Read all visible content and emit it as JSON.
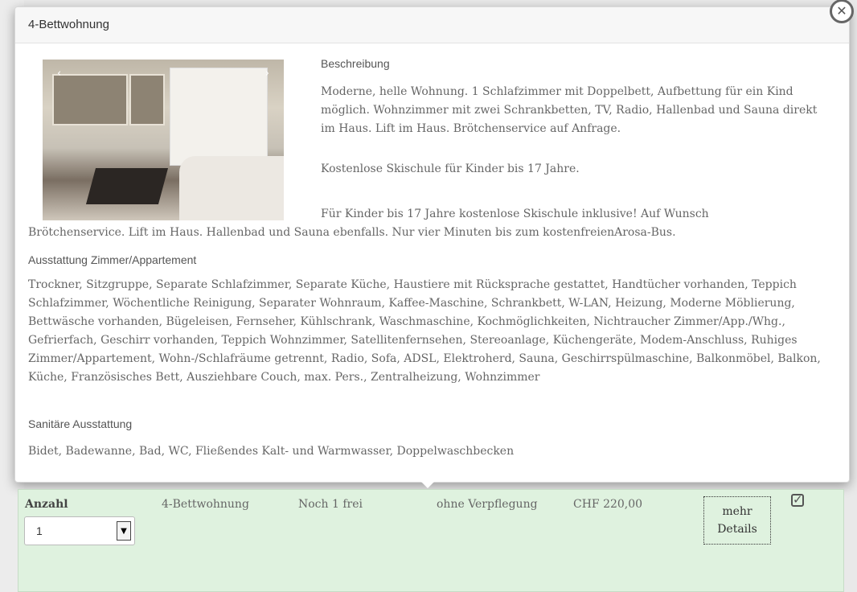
{
  "popup": {
    "title": "4-Bettwohnung",
    "close_icon": "close-icon",
    "description_label": "Beschreibung",
    "description_text": "Moderne, helle Wohnung. 1 Schlafzimmer mit Doppelbett, Aufbettung für ein Kind möglich. Wohnzimmer mit zwei Schrankbetten, TV, Radio, Hallenbad und Sauna direkt im Haus. Lift im Haus. Brötchenservice auf Anfrage.",
    "description_extra": "Kostenlose Skischule für Kinder bis 17 Jahre.",
    "description_more_line1": "Für Kinder bis 17 Jahre kostenlose Skischule inklusive! Auf Wunsch",
    "description_more_line2": "Brötchenservice. Lift im Haus. Hallenbad und Sauna ebenfalls. Nur vier Minuten bis zum kostenfreienArosa-Bus.",
    "equipment_label": "Ausstattung Zimmer/Appartement",
    "equipment_text": "Trockner, Sitzgruppe, Separate Schlafzimmer, Separate Küche, Haustiere mit Rücksprache gestattet, Handtücher vorhanden, Teppich Schlafzimmer, Wöchentliche Reinigung, Separater Wohnraum, Kaffee-Maschine, Schrankbett, W-LAN, Heizung, Moderne Möblierung, Bettwäsche vorhanden, Bügeleisen, Fernseher, Kühlschrank, Waschmaschine, Kochmöglichkeiten, Nichtraucher Zimmer/App./Whg., Gefrierfach, Geschirr vorhanden, Teppich Wohnzimmer, Satellitenfernsehen, Stereoanlage, Küchengeräte, Modem-Anschluss, Ruhiges Zimmer/Appartement, Wohn-/Schlafräume getrennt, Radio, Sofa, ADSL, Elektroherd, Sauna, Geschirrspülmaschine, Balkonmöbel, Balkon, Küche, Französisches Bett, Ausziehbare Couch, max. Pers., Zentralheizung, Wohnzimmer",
    "sanitary_label": "Sanitäre Ausstattung",
    "sanitary_text": "Bidet, Badewanne, Bad, WC, Fließendes Kalt- und Warmwasser, Doppelwaschbecken",
    "photo_prev": "‹",
    "photo_next": "›"
  },
  "booking": {
    "anzahl_label": "Anzahl",
    "quantity_value": "1",
    "room_type": "4-Bettwohnung",
    "availability": "Noch 1 frei",
    "board": "ohne Verpflegung",
    "price": "CHF 220,00",
    "details_line1": "mehr",
    "details_line2": "Details",
    "select_arrow": "▼",
    "check_icon": "check-square-icon"
  }
}
